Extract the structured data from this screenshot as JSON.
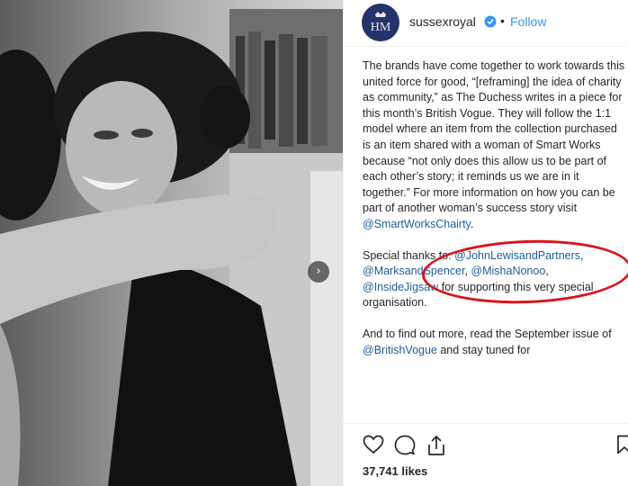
{
  "account": {
    "username": "sussexroyal",
    "separator": "•",
    "follow_label": "Follow"
  },
  "caption": {
    "para1": [
      {
        "text": "The brands have come together to work towards this united force for good, “[reframing] the idea of charity as community,” as The Duchess writes in a piece for this month’s British Vogue. They will follow the 1:1 model where an item from the collection purchased is an item shared with a woman of Smart Works because “not only does this allow us to be part of each other’s story; it reminds us we are in it together.” For more information on how you can be part of another woman’s success story visit "
      },
      {
        "mention": "@SmartWorksChairty"
      },
      {
        "text": "."
      }
    ],
    "para2": [
      {
        "text": "Special thanks to: "
      },
      {
        "mention": "@JohnLewisandPartners"
      },
      {
        "text": ", "
      },
      {
        "mention": "@MarksandSpencer"
      },
      {
        "text": ", "
      },
      {
        "mention": "@MishaNonoo"
      },
      {
        "text": ", "
      },
      {
        "mention": "@InsideJigsaw"
      },
      {
        "text": " for supporting this very special organisation."
      }
    ],
    "para3": [
      {
        "text": "And to find out more, read the September issue of "
      },
      {
        "mention": "@BritishVogue"
      },
      {
        "text": " and stay tuned for"
      }
    ]
  },
  "engagement": {
    "likes_label": "37,741 likes"
  },
  "icons": {
    "heart": "heart-icon",
    "comment": "comment-icon",
    "share": "share-icon",
    "bookmark": "bookmark-icon",
    "next": "chevron-right-icon",
    "verified": "verified-badge-icon"
  },
  "colors": {
    "follow": "#3897f0",
    "mention": "#1b5e9c",
    "highlight_circle": "#d9141b",
    "avatar_bg": "#23336b"
  }
}
